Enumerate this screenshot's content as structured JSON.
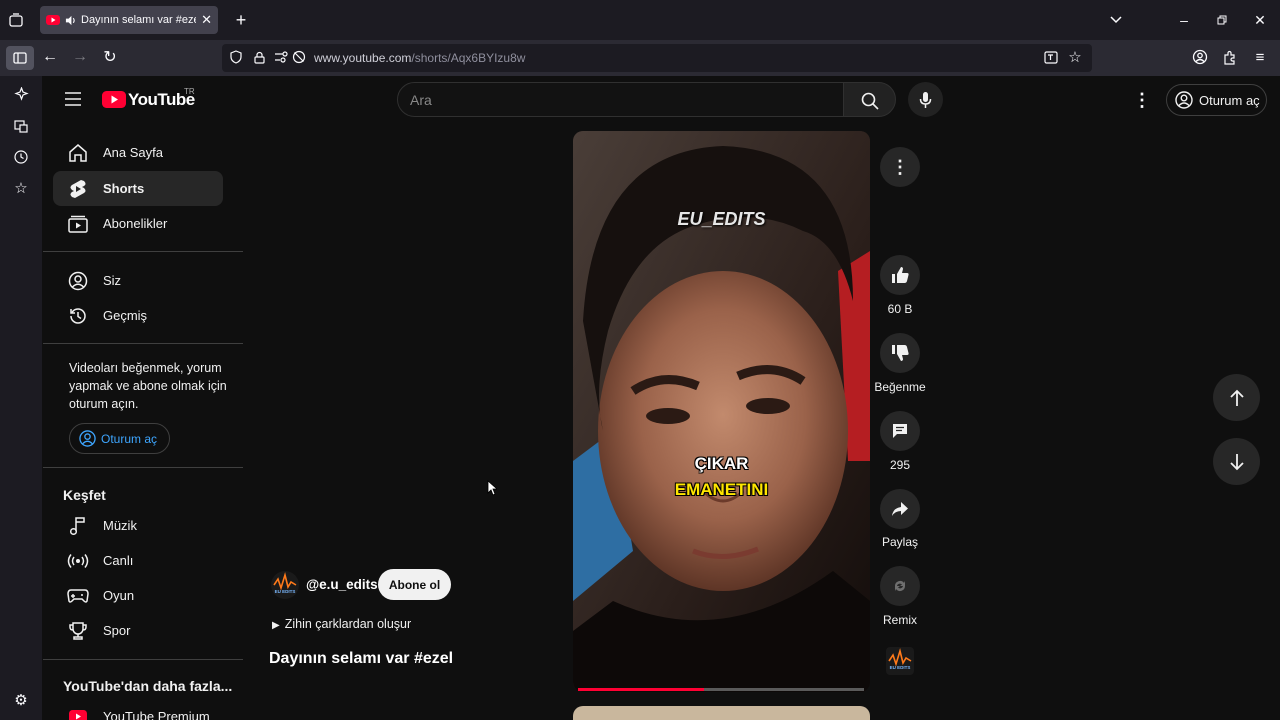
{
  "browser": {
    "tab_title": "Dayının selamı var #ezel - Y",
    "url_host": "www.youtube.com",
    "url_path": "/shorts/Aqx6BYIzu8w"
  },
  "header": {
    "logo_text": "YouTube",
    "country_code": "TR",
    "search_placeholder": "Ara",
    "signin_label": "Oturum aç"
  },
  "sidebar": {
    "main": [
      {
        "label": "Ana Sayfa",
        "icon": "home-icon"
      },
      {
        "label": "Shorts",
        "icon": "shorts-icon"
      },
      {
        "label": "Abonelikler",
        "icon": "subscriptions-icon"
      }
    ],
    "you": [
      {
        "label": "Siz",
        "icon": "user-icon"
      },
      {
        "label": "Geçmiş",
        "icon": "history-icon"
      }
    ],
    "signin_prompt": "Videoları beğenmek, yorum yapmak ve abone olmak için oturum açın.",
    "signin_label": "Oturum aç",
    "explore_title": "Keşfet",
    "explore": [
      {
        "label": "Müzik",
        "icon": "music-icon"
      },
      {
        "label": "Canlı",
        "icon": "live-icon"
      },
      {
        "label": "Oyun",
        "icon": "gaming-icon"
      },
      {
        "label": "Spor",
        "icon": "trophy-icon"
      }
    ],
    "more_title": "YouTube'dan daha fazla...",
    "more": [
      {
        "label": "YouTube Premium",
        "icon": "youtube-premium-icon"
      }
    ]
  },
  "short": {
    "watermark": "EU_EDITS",
    "caption_line1": "ÇIKAR",
    "caption_line2": "EMANETINI",
    "channel": "@e.u_edits",
    "channel_avatar_text": "EU EDITS",
    "subscribe_label": "Abone ol",
    "description": "Zihin çarklardan oluşur",
    "title": "Dayının selamı var #ezel",
    "progress_percent": 44
  },
  "actions": {
    "like_count": "60 B",
    "dislike_label": "Beğenme",
    "comment_count": "295",
    "share_label": "Paylaş",
    "remix_label": "Remix"
  },
  "colors": {
    "brand_red": "#ff0033",
    "link_blue": "#3ea6ff",
    "background": "#0f0f0f"
  }
}
